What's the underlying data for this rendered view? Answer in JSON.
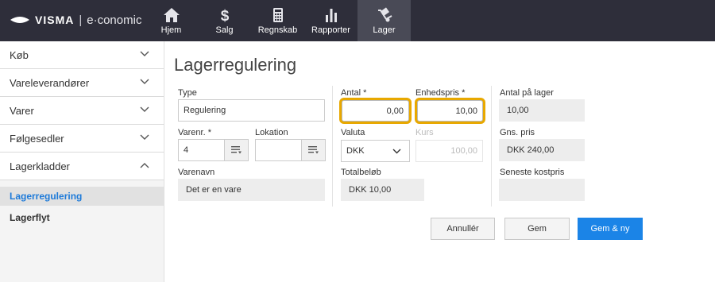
{
  "brand": {
    "visma": "VISMA",
    "product": "e·conomic"
  },
  "nav": [
    {
      "label": "Hjem",
      "icon": "home-icon"
    },
    {
      "label": "Salg",
      "icon": "dollar-icon"
    },
    {
      "label": "Regnskab",
      "icon": "calculator-icon"
    },
    {
      "label": "Rapporter",
      "icon": "bar-chart-icon"
    },
    {
      "label": "Lager",
      "icon": "hand-truck-icon"
    }
  ],
  "sidebar": {
    "sections": [
      {
        "label": "Køb"
      },
      {
        "label": "Vareleverandører"
      },
      {
        "label": "Varer"
      },
      {
        "label": "Følgesedler"
      },
      {
        "label": "Lagerkladder"
      }
    ],
    "subitems": [
      {
        "label": "Lagerregulering"
      },
      {
        "label": "Lagerflyt"
      }
    ]
  },
  "page": {
    "title": "Lagerregulering"
  },
  "form": {
    "type_label": "Type",
    "type_value": "Regulering",
    "varenr_label": "Varenr. *",
    "varenr_value": "4",
    "lokation_label": "Lokation",
    "lokation_value": "",
    "varenavn_label": "Varenavn",
    "varenavn_value": "Det er en vare",
    "antal_label": "Antal *",
    "antal_value": "0,00",
    "enhedspris_label": "Enhedspris *",
    "enhedspris_value": "10,00",
    "valuta_label": "Valuta",
    "valuta_value": "DKK",
    "kurs_label": "Kurs",
    "kurs_value": "100,00",
    "totalbelob_label": "Totalbeløb",
    "totalbelob_value": "DKK 10,00",
    "antal_lager_label": "Antal på lager",
    "antal_lager_value": "10,00",
    "gns_pris_label": "Gns. pris",
    "gns_pris_value": "DKK 240,00",
    "seneste_label": "Seneste kostpris",
    "seneste_value": ""
  },
  "actions": {
    "cancel": "Annullér",
    "save": "Gem",
    "save_new": "Gem & ny"
  },
  "colors": {
    "topbar": "#2e2e3a",
    "active_nav": "#494a56",
    "primary": "#1b84e7",
    "highlight": "#e8a800",
    "link": "#1d7ad9"
  }
}
